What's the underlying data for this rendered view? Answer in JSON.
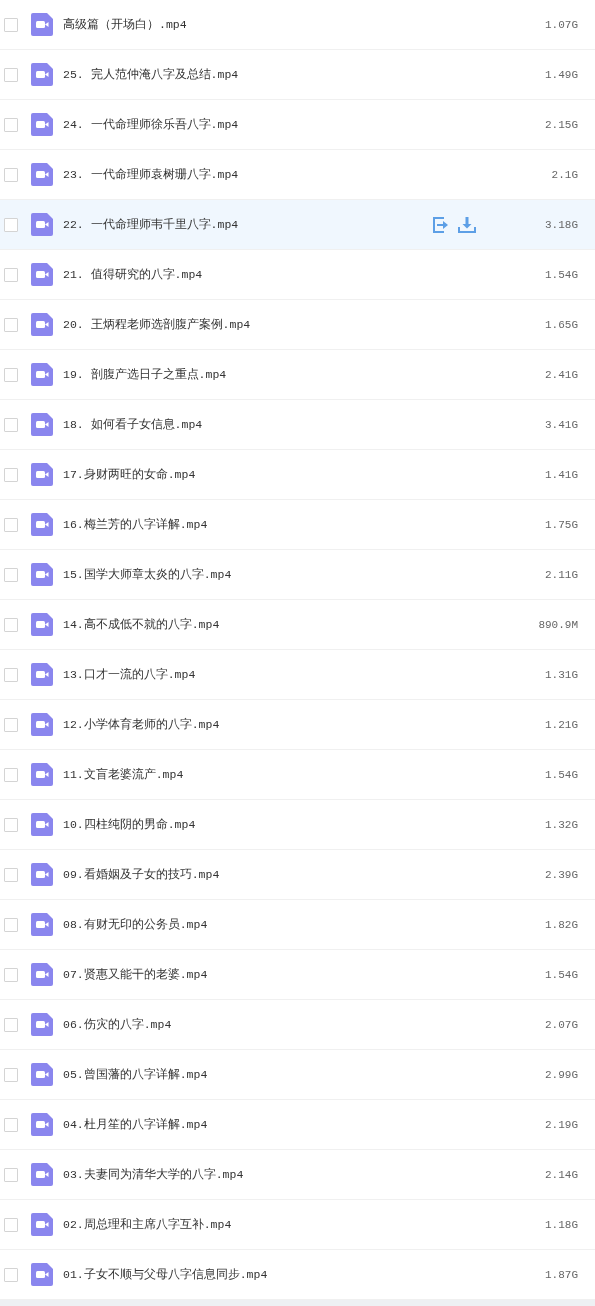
{
  "files": [
    {
      "name": "高级篇（开场白）.mp4",
      "size": "1.07G",
      "checked": false,
      "hovered": false
    },
    {
      "name": "25. 完人范仲淹八字及总结.mp4",
      "size": "1.49G",
      "checked": false,
      "hovered": false
    },
    {
      "name": "24. 一代命理师徐乐吾八字.mp4",
      "size": "2.15G",
      "checked": false,
      "hovered": false
    },
    {
      "name": "23. 一代命理师袁树珊八字.mp4",
      "size": "2.1G",
      "checked": false,
      "hovered": false
    },
    {
      "name": "22. 一代命理师韦千里八字.mp4",
      "size": "3.18G",
      "checked": false,
      "hovered": true
    },
    {
      "name": "21. 值得研究的八字.mp4",
      "size": "1.54G",
      "checked": false,
      "hovered": false
    },
    {
      "name": "20. 王炳程老师选剖腹产案例.mp4",
      "size": "1.65G",
      "checked": false,
      "hovered": false
    },
    {
      "name": "19. 剖腹产选日子之重点.mp4",
      "size": "2.41G",
      "checked": false,
      "hovered": false
    },
    {
      "name": "18. 如何看子女信息.mp4",
      "size": "3.41G",
      "checked": false,
      "hovered": false
    },
    {
      "name": "17.身财两旺的女命.mp4",
      "size": "1.41G",
      "checked": false,
      "hovered": false
    },
    {
      "name": "16.梅兰芳的八字详解.mp4",
      "size": "1.75G",
      "checked": false,
      "hovered": false
    },
    {
      "name": "15.国学大师章太炎的八字.mp4",
      "size": "2.11G",
      "checked": false,
      "hovered": false
    },
    {
      "name": "14.高不成低不就的八字.mp4",
      "size": "890.9M",
      "checked": false,
      "hovered": false
    },
    {
      "name": "13.口才一流的八字.mp4",
      "size": "1.31G",
      "checked": false,
      "hovered": false
    },
    {
      "name": "12.小学体育老师的八字.mp4",
      "size": "1.21G",
      "checked": false,
      "hovered": false
    },
    {
      "name": "11.文盲老婆流产.mp4",
      "size": "1.54G",
      "checked": false,
      "hovered": false
    },
    {
      "name": "10.四柱纯阴的男命.mp4",
      "size": "1.32G",
      "checked": false,
      "hovered": false
    },
    {
      "name": "09.看婚姻及子女的技巧.mp4",
      "size": "2.39G",
      "checked": false,
      "hovered": false
    },
    {
      "name": "08.有财无印的公务员.mp4",
      "size": "1.82G",
      "checked": false,
      "hovered": false
    },
    {
      "name": "07.贤惠又能干的老婆.mp4",
      "size": "1.54G",
      "checked": false,
      "hovered": false
    },
    {
      "name": "06.伤灾的八字.mp4",
      "size": "2.07G",
      "checked": false,
      "hovered": false
    },
    {
      "name": "05.曾国藩的八字详解.mp4",
      "size": "2.99G",
      "checked": false,
      "hovered": false
    },
    {
      "name": "04.杜月笙的八字详解.mp4",
      "size": "2.19G",
      "checked": false,
      "hovered": false
    },
    {
      "name": "03.夫妻同为清华大学的八字.mp4",
      "size": "2.14G",
      "checked": false,
      "hovered": false
    },
    {
      "name": "02.周总理和主席八字互补.mp4",
      "size": "1.18G",
      "checked": false,
      "hovered": false
    },
    {
      "name": "01.子女不顺与父母八字信息同步.mp4",
      "size": "1.87G",
      "checked": false,
      "hovered": false
    }
  ]
}
